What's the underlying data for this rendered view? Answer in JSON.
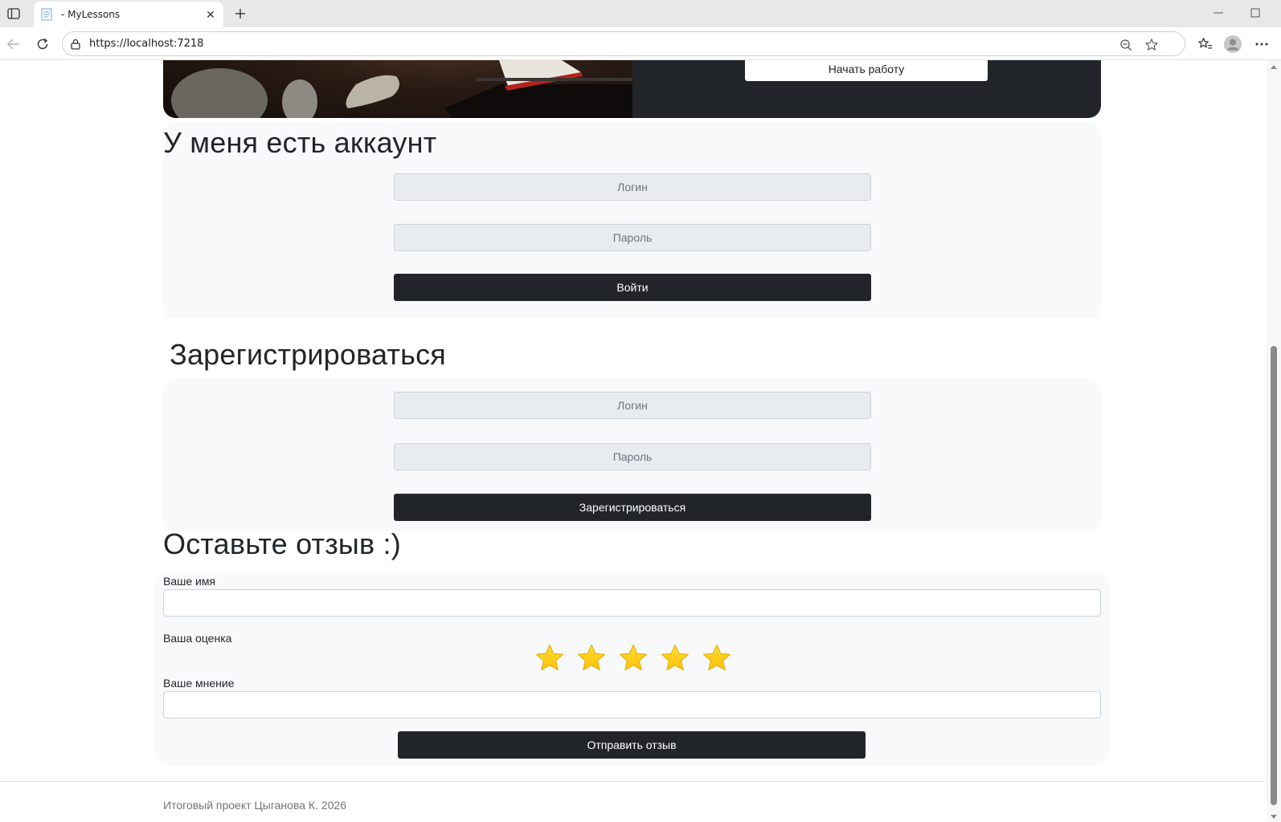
{
  "browser": {
    "tab_title": "- MyLessons",
    "url": "https://localhost:7218"
  },
  "hero": {
    "cta_label": "Начать работу"
  },
  "login": {
    "title": "У меня есть аккаунт",
    "login_placeholder": "Логин",
    "password_placeholder": "Пароль",
    "submit_label": "Войти"
  },
  "register": {
    "title": "Зарегистрироваться",
    "login_placeholder": "Логин",
    "password_placeholder": "Пароль",
    "submit_label": "Зарегистрироваться"
  },
  "review": {
    "title": "Оставьте отзыв :)",
    "name_label": "Ваше имя",
    "name_value": "",
    "rating_label": "Ваша оценка",
    "rating": 5,
    "rating_max": 5,
    "star_color": "#ffc107",
    "opinion_label": "Ваше мнение",
    "opinion_value": "",
    "submit_label": "Отправить отзыв"
  },
  "footer": {
    "text": "Итоговый проект Цыганова К. 2026"
  }
}
